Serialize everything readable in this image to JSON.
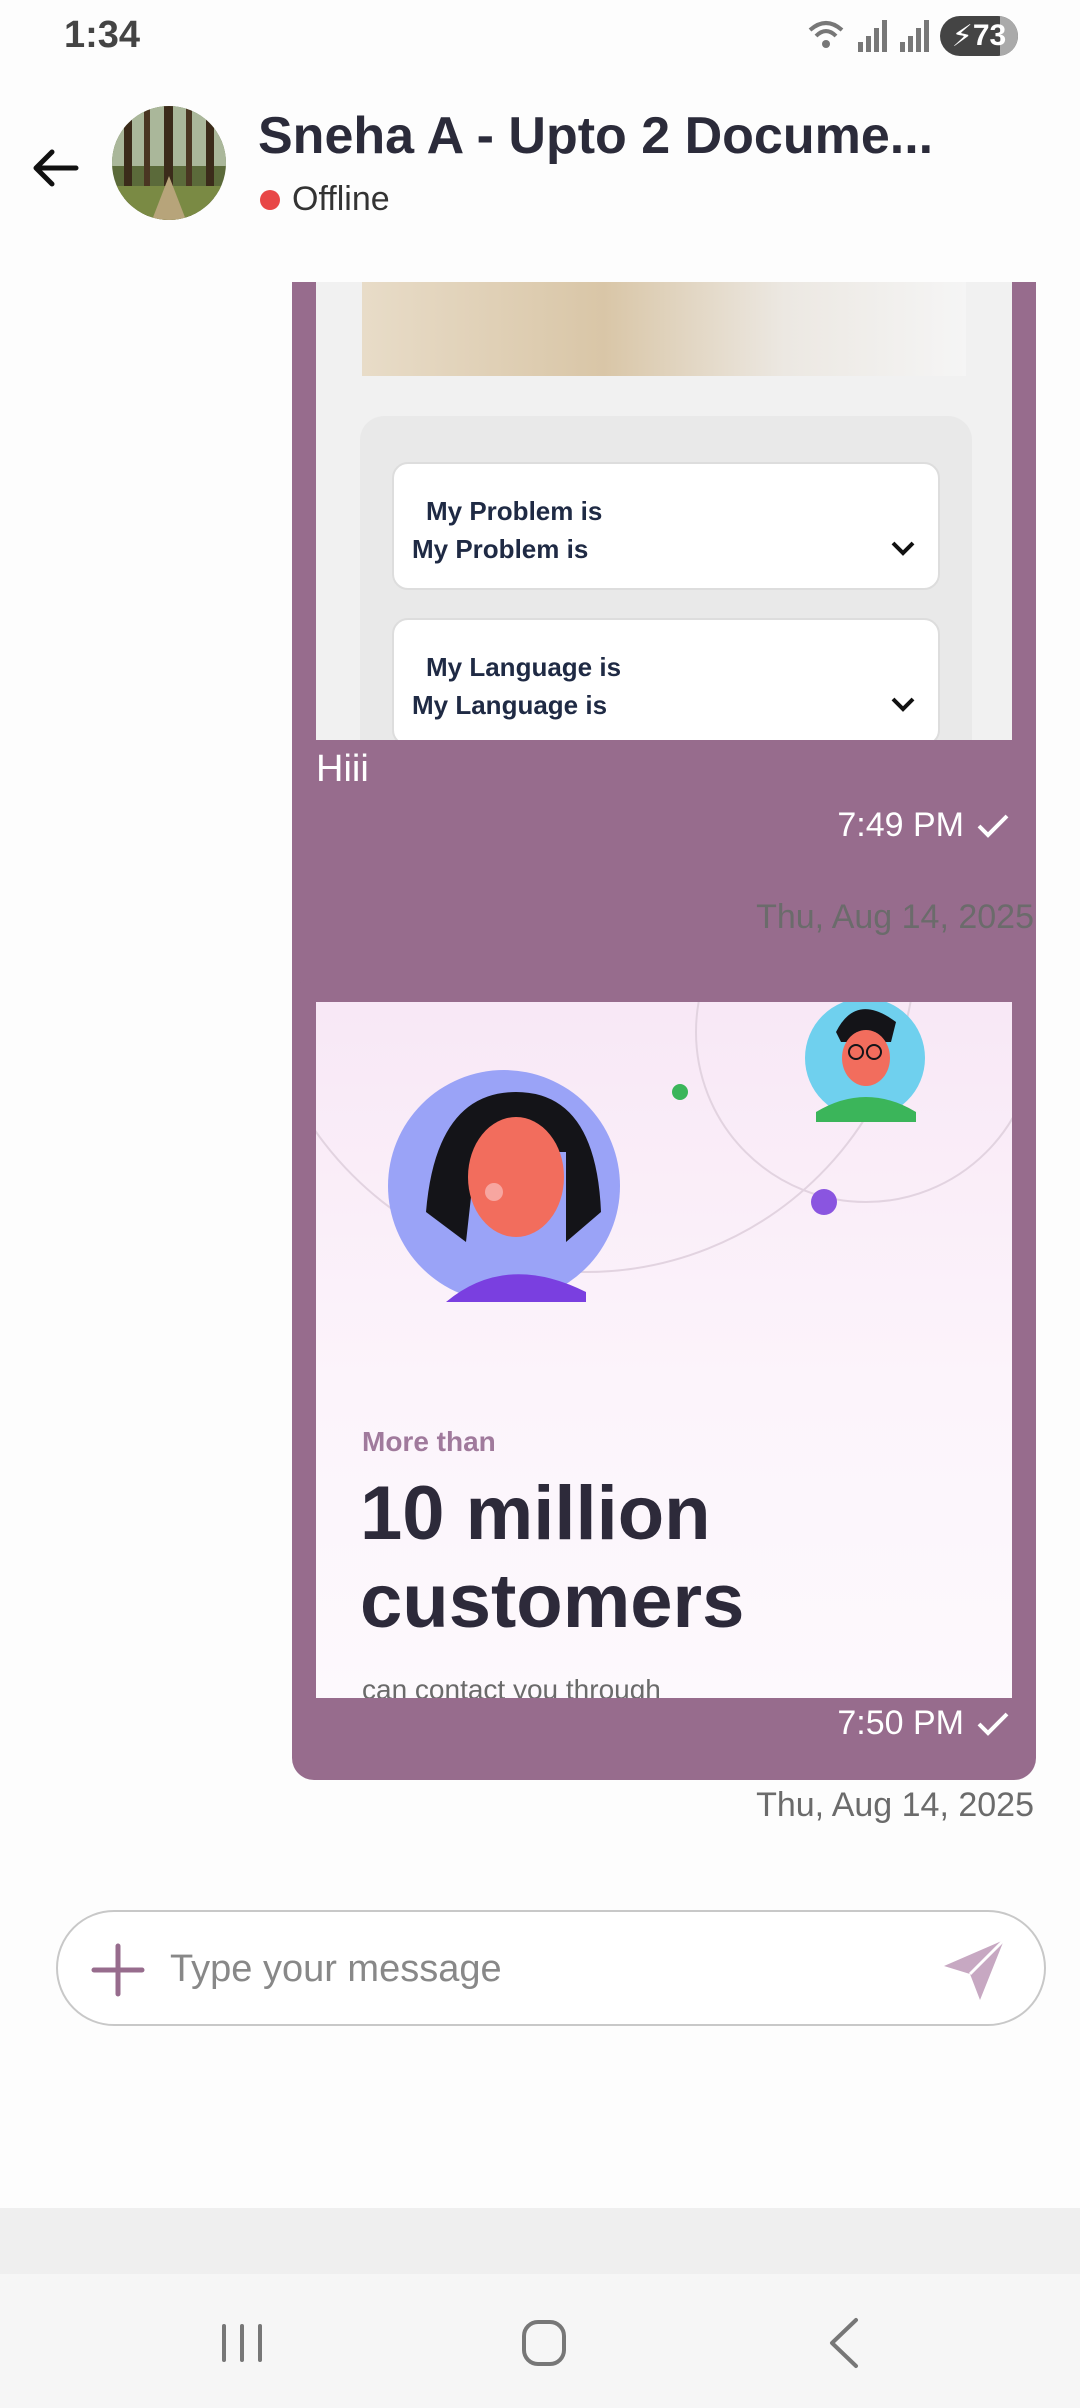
{
  "status_bar": {
    "time": "1:34",
    "battery": "73",
    "icons": [
      "wifi-icon",
      "signal-icon",
      "signal-icon",
      "battery-charging-icon"
    ]
  },
  "header": {
    "contact_name": "Sneha A - Upto 2 Docume...",
    "presence": "Offline",
    "presence_color": "#e84646",
    "back_icon": "arrow-left-icon"
  },
  "messages": [
    {
      "form": {
        "field1_label": "My Problem is",
        "field1_value": "My Problem is",
        "field2_label": "My Language is",
        "field2_value": "My Language is"
      },
      "text": "Hiii",
      "time": "7:49 PM",
      "date": "Thu, Aug 14, 2025"
    },
    {
      "promo": {
        "kicker": "More than",
        "headline": "10 million customers",
        "subtext": "can contact you through"
      },
      "time": "7:50 PM",
      "date": "Thu, Aug 14, 2025"
    }
  ],
  "composer": {
    "placeholder": "Type your message"
  },
  "colors": {
    "bubble": "#976c8d",
    "accent": "#a07a9c"
  }
}
